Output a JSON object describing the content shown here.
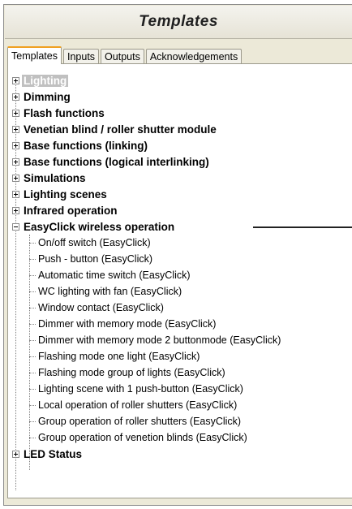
{
  "window": {
    "title": "Templates"
  },
  "tabs": [
    {
      "label": "Templates",
      "active": true
    },
    {
      "label": "Inputs",
      "active": false
    },
    {
      "label": "Outputs",
      "active": false
    },
    {
      "label": "Acknowledgements",
      "active": false
    }
  ],
  "tree": {
    "groups": [
      {
        "label": "Lighting",
        "expanded": false,
        "selected": true
      },
      {
        "label": "Dimming",
        "expanded": false
      },
      {
        "label": "Flash functions",
        "expanded": false
      },
      {
        "label": "Venetian blind / roller shutter module",
        "expanded": false
      },
      {
        "label": "Base functions (linking)",
        "expanded": false
      },
      {
        "label": "Base functions (logical interlinking)",
        "expanded": false
      },
      {
        "label": "Simulations",
        "expanded": false
      },
      {
        "label": "Lighting scenes",
        "expanded": false
      },
      {
        "label": "Infrared operation",
        "expanded": false
      },
      {
        "label": "EasyClick wireless operation",
        "expanded": true
      },
      {
        "label": "LED Status",
        "expanded": false
      }
    ],
    "easyclick_items": [
      "On/off switch (EasyClick)",
      "Push - button (EasyClick)",
      "Automatic time switch (EasyClick)",
      "WC lighting with fan (EasyClick)",
      "Window contact (EasyClick)",
      "Dimmer with memory mode (EasyClick)",
      "Dimmer with memory mode 2 buttonmode (EasyClick)",
      "Flashing mode one light (EasyClick)",
      "Flashing mode group of lights (EasyClick)",
      "Lighting scene with 1 push-button (EasyClick)",
      "Local operation of roller shutters (EasyClick)",
      "Group operation of roller shutters (EasyClick)",
      "Group operation of venetion blinds (EasyClick)"
    ]
  }
}
